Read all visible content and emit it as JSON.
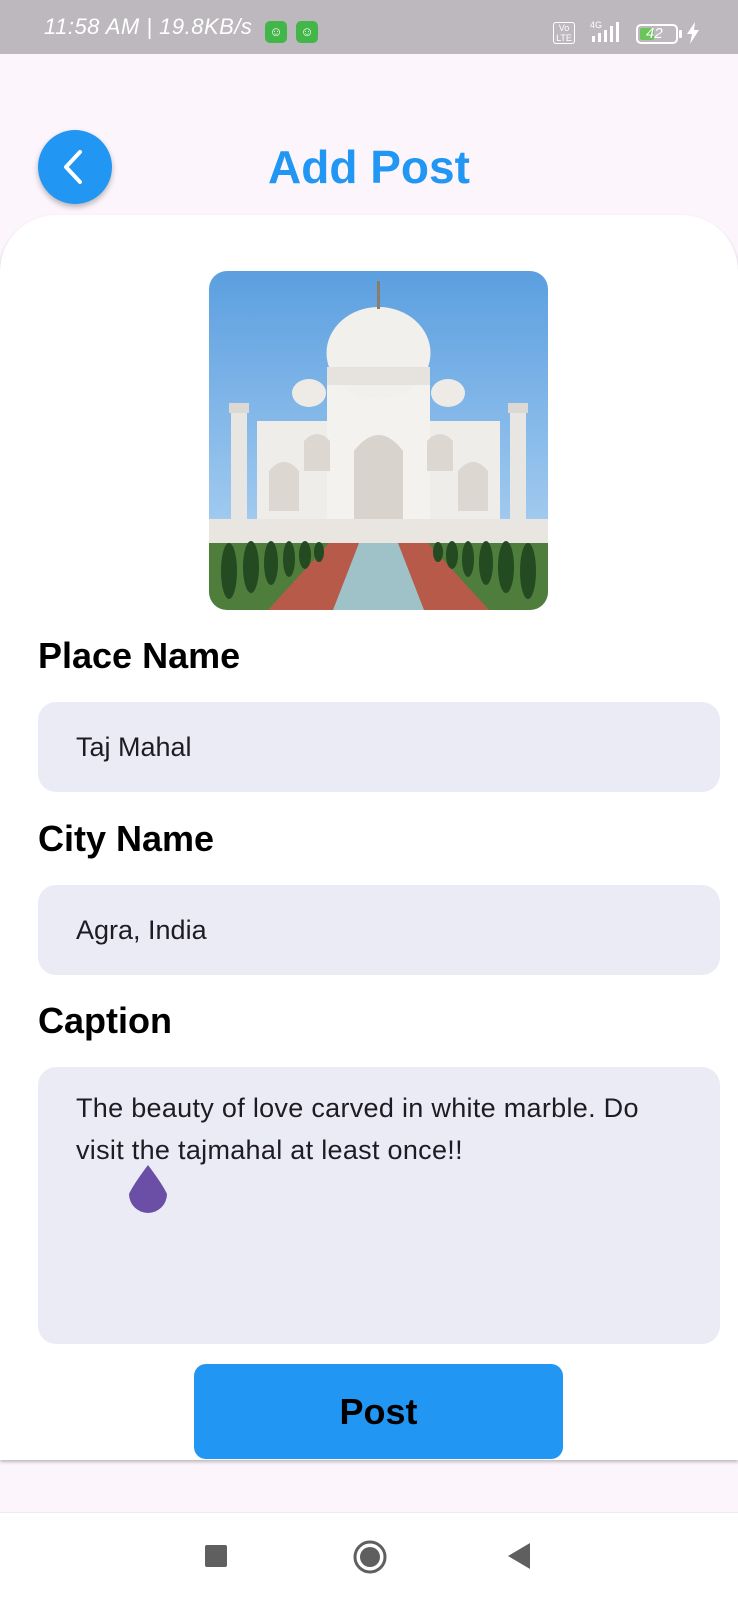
{
  "status_bar": {
    "time": "11:58 AM | 19.8KB/s",
    "volte": "Vo LTE",
    "network": "4G",
    "battery": "42",
    "battery_level": 0.42
  },
  "header": {
    "title": "Add Post",
    "back_icon": "chevron-left-icon",
    "accent_color": "#2196f3"
  },
  "form": {
    "image_description": "taj-mahal-photo",
    "place_label": "Place Name",
    "place_value": "Taj Mahal",
    "city_label": "City Name",
    "city_value": "Agra, India",
    "caption_label": "Caption",
    "caption_value": "The beauty of love carved in white marble. Do visit the tajmahal at least once!!",
    "submit_label": "Post"
  },
  "nav": {
    "recents_icon": "square-icon",
    "home_icon": "circle-icon",
    "back_icon": "triangle-back-icon"
  }
}
